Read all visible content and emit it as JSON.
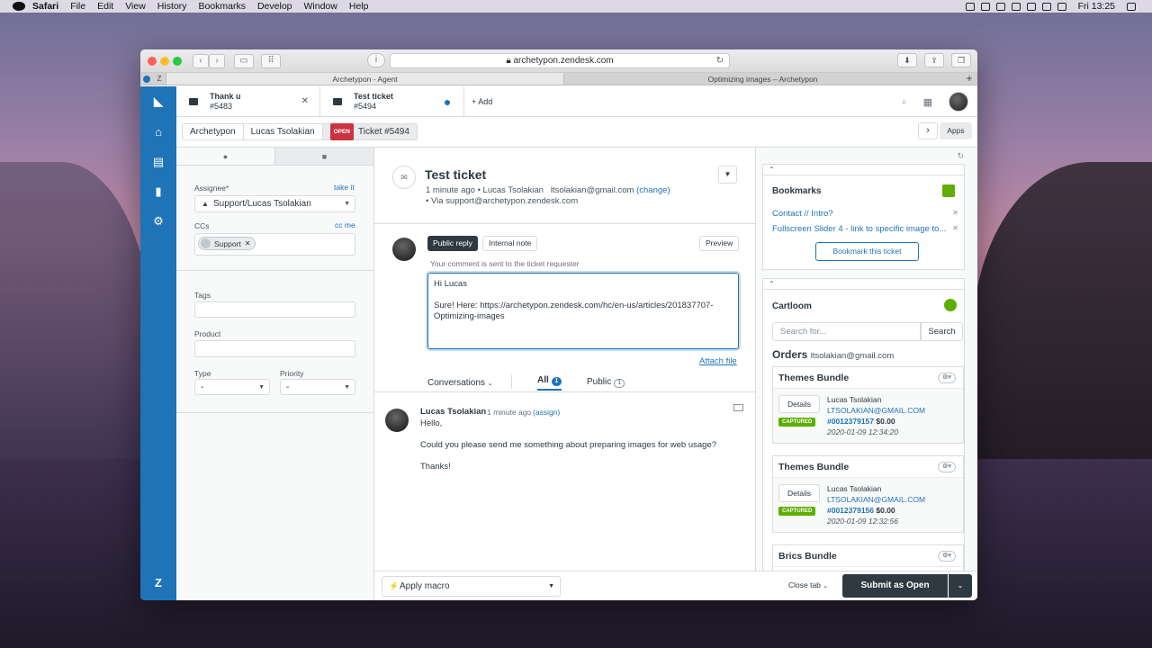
{
  "menubar": {
    "app": "Safari",
    "items": [
      "File",
      "Edit",
      "View",
      "History",
      "Bookmarks",
      "Develop",
      "Window",
      "Help"
    ],
    "clock": "Fri 13:25"
  },
  "browser": {
    "url": "archetypon.zendesk.com",
    "tabs": [
      "Archetypon - Agent",
      "Optimizing images – Archetypon"
    ]
  },
  "workspace_tabs": [
    {
      "title": "Thank u",
      "id": "#5483"
    },
    {
      "title": "Test ticket",
      "id": "#5494"
    }
  ],
  "add_label": "+ Add",
  "breadcrumb": {
    "org": "Archetypon",
    "user": "Lucas Tsolakian",
    "status": "OPEN",
    "ticket": "Ticket #5494"
  },
  "apps_label": "Apps",
  "left": {
    "assignee_label": "Assignee*",
    "take_it": "take it",
    "assignee_value": "Support/Lucas Tsolakian",
    "ccs_label": "CCs",
    "cc_me": "cc me",
    "cc_pill": "Support",
    "tags_label": "Tags",
    "product_label": "Product",
    "type_label": "Type",
    "type_value": "-",
    "priority_label": "Priority",
    "priority_value": "-"
  },
  "ticket": {
    "title": "Test ticket",
    "meta_time": "1 minute ago",
    "meta_user": "Lucas Tsolakian",
    "meta_email": "ltsolakian@gmail.com",
    "meta_change": "(change)",
    "via": "• Via support@archetypon.zendesk.com"
  },
  "composer": {
    "public_reply": "Public reply",
    "internal_note": "Internal note",
    "preview": "Preview",
    "hint": "Your comment is sent to the ticket requester",
    "body": "Hi Lucas\n\nSure! Here: https://archetypon.zendesk.com/hc/en-us/articles/201837707-Optimizing-images",
    "attach": "Attach file"
  },
  "filters": {
    "conversations": "Conversations",
    "all": "All",
    "all_count": "1",
    "public": "Public",
    "public_count": "1"
  },
  "message": {
    "author": "Lucas Tsolakian",
    "time": "1 minute ago",
    "assign": "(assign)",
    "lines": [
      "Hello,",
      "Could you please send me something about preparing images for web usage?",
      "Thanks!"
    ]
  },
  "bottom": {
    "macro": "Apply macro",
    "close_tab": "Close tab",
    "submit": "Submit as Open"
  },
  "bookmarks": {
    "title": "Bookmarks",
    "items": [
      "Contact // Intro?",
      "Fullscreen Slider 4 - link to specific image to..."
    ],
    "button": "Bookmark this ticket"
  },
  "cartloom": {
    "title": "Cartloom",
    "search_placeholder": "Search for...",
    "search_button": "Search",
    "orders_label": "Orders",
    "orders_email": "ltsolakian@gmail.com",
    "orders": [
      {
        "product": "Themes Bundle",
        "name": "Lucas Tsolakian",
        "email": "LTSOLAKIAN@GMAIL.COM",
        "number": "#0012379157",
        "amount": "$0.00",
        "date": "2020-01-09 12:34:20",
        "status": "CAPTURED"
      },
      {
        "product": "Themes Bundle",
        "name": "Lucas Tsolakian",
        "email": "LTSOLAKIAN@GMAIL.COM",
        "number": "#0012379156",
        "amount": "$0.00",
        "date": "2020-01-09 12:32:56",
        "status": "CAPTURED"
      },
      {
        "product": "Brics Bundle"
      }
    ],
    "details_label": "Details"
  },
  "colors": {
    "nav": "#1f73b7",
    "open_badge": "#cc3340",
    "captured": "#5eae00",
    "submit": "#2f3941"
  }
}
